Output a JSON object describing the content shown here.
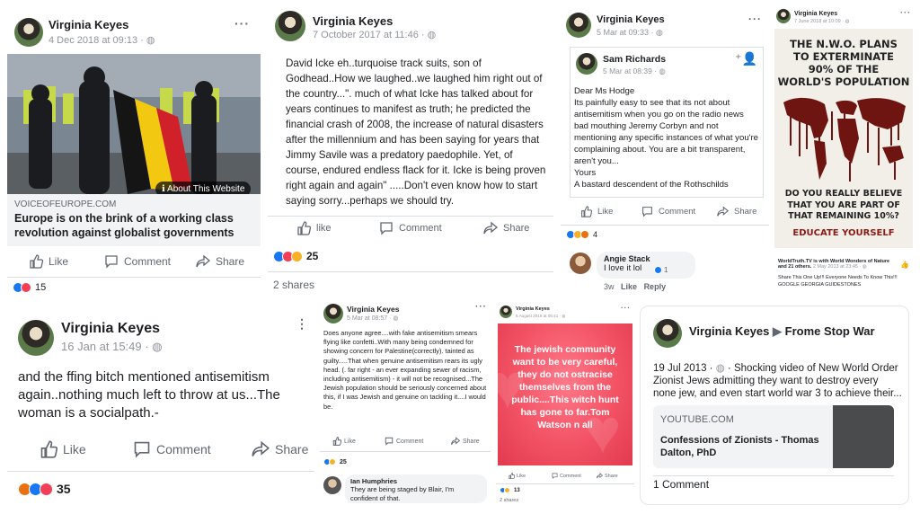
{
  "post1": {
    "author": "Virginia Keyes",
    "timestamp": "4 Dec 2018 at 09:13 · ",
    "link_domain": "VOICEOFEUROPE.COM",
    "link_title": "Europe is on the brink of a working class revolution against globalist governments",
    "about_label": "About This Website",
    "like": "Like",
    "comment": "Comment",
    "share": "Share",
    "reaction_count": "15"
  },
  "post2": {
    "author": "Virginia Keyes",
    "timestamp": "7 October 2017 at 11:46 · ",
    "text": "David Icke eh..turquoise track suits, son of Godhead..How we laughed..we laughed him right out of the country...\". much of what Icke has talked about for years continues to manifest as truth; he predicted the financial crash of 2008, the increase of natural disasters after the millennium and has been saying for years that Jimmy Savile was a predatory paedophile. Yet, of course, endured endless flack for it. Icke is being proven right again and again\" .....Don't even know how to start saying sorry...perhaps we should try.",
    "like": "like",
    "comment": "Comment",
    "share": "Share",
    "reaction_count": "25",
    "shares": "2 shares"
  },
  "post3": {
    "author": "Virginia Keyes",
    "timestamp": "5 Mar at 09:33 · ",
    "inner_author": "Sam Richards",
    "inner_timestamp": "5 Mar at 08:39 · ",
    "inner_text": "Dear Ms Hodge\nIts painfully easy to see that its not about antisemitism when you go on the radio news bad mouthing Jeremy Corbyn and not mentioning any specific instances of what you're complaining about. You are a bit transparent, aren't you...\nYours\nA bastard descendent of the Rothschilds",
    "like": "Like",
    "comment": "Comment",
    "share": "Share",
    "reaction_count": "4",
    "commenter": "Angie Stack",
    "comment_text": "I love it lol",
    "comment_reacts": "1",
    "comment_age": "3w",
    "comment_like": "Like",
    "comment_reply": "Reply"
  },
  "post4": {
    "author": "Virginia Keyes",
    "timestamp": "7 June 2018 at 10:09 · ",
    "poster_line1": "THE N.W.O. PLANS",
    "poster_line2": "TO EXTERMINATE",
    "poster_line3": "90% OF THE",
    "poster_line4": "WORLD'S POPULATION",
    "poster_q1": "DO YOU REALLY BELIEVE",
    "poster_q2": "THAT YOU ARE PART OF",
    "poster_q3": "THAT REMAINING 10%?",
    "poster_cta": "EDUCATE YOURSELF",
    "share_source": "WorldTruth.TV is with World Wonders of Nature and 21 others.",
    "share_time": "2 May 2013 at 23:45 · ",
    "share_text": "Share This One Up!!! Everyone Needs To Know This!!! GOOGLE GEORGIA GUIDESTONES"
  },
  "post5": {
    "author": "Virginia Keyes",
    "timestamp": "16 Jan at 15:49 · ",
    "text": "and the ffing bitch mentioned antisemitism again..nothing much left to throw at us...The woman is a socialpath.-",
    "like": "Like",
    "comment": "Comment",
    "share": "Share",
    "reaction_count": "35"
  },
  "post6": {
    "author": "Virginia Keyes",
    "timestamp": "5 Mar at 08:57 · ",
    "text": "Does  anyone agree....with fake antisemitism smears flying like confetti..With many being condemned for showing concern for Palestine(correctly).  tainted as guilty.....That when genuine antisemitism rears its ugly head. (. far right - an ever expanding sewer of racism, including antisemitism) - it will not be recognised...The Jewish population should be seriously  concerned about this, if I was Jewish and genuine on tackling it....I would be.",
    "like": "Like",
    "comment": "Comment",
    "share": "Share",
    "reaction_count": "25",
    "commenter": "Ian Humphries",
    "comment_text": "They are being staged by Blair, I'm confident of that."
  },
  "post7": {
    "author": "Virginia Keyes",
    "timestamp": "5 August 2018 at 05:41 · ",
    "card_text": "The jewish community want to be very careful, they do not ostracise themselves from the public....This witch hunt has gone to far.Tom Watson n all",
    "like": "Like",
    "comment": "Comment",
    "share": "Share",
    "reaction_count": "13",
    "shares": "2 shares"
  },
  "post8": {
    "author": "Virginia Keyes",
    "group": "Frome Stop War",
    "timestamp": "19 Jul 2013 · ",
    "text": "Shocking video of New World Order Zionist Jews admitting they want to destroy every none jew, and even start world war 3 to achieve their...",
    "link_domain": "YOUTUBE.COM",
    "link_title": "Confessions of Zionists - Thomas Dalton, PhD",
    "comments": "1 Comment"
  },
  "colors": {
    "fb_blue": "#1877f2",
    "love_red": "#f33e58",
    "text": "#1c1e21",
    "meta": "#90949c"
  }
}
